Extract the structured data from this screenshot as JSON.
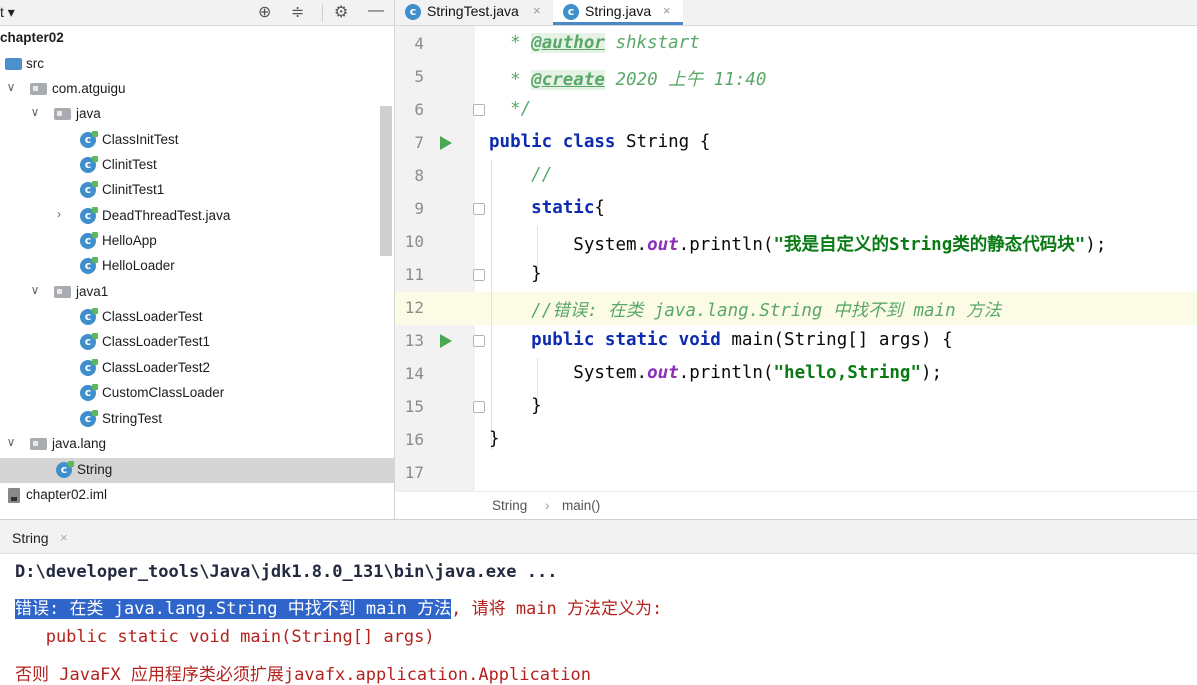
{
  "project_panel": {
    "title": "t",
    "tree": [
      {
        "label": "chapter02",
        "type": "module"
      },
      {
        "label": "src",
        "type": "src-folder"
      },
      {
        "label": "com.atguigu",
        "type": "package"
      },
      {
        "label": "java",
        "type": "package"
      },
      {
        "label": "ClassInitTest",
        "type": "class"
      },
      {
        "label": "ClinitTest",
        "type": "class"
      },
      {
        "label": "ClinitTest1",
        "type": "class"
      },
      {
        "label": "DeadThreadTest.java",
        "type": "class"
      },
      {
        "label": "HelloApp",
        "type": "class"
      },
      {
        "label": "HelloLoader",
        "type": "class"
      },
      {
        "label": "java1",
        "type": "package"
      },
      {
        "label": "ClassLoaderTest",
        "type": "class"
      },
      {
        "label": "ClassLoaderTest1",
        "type": "class"
      },
      {
        "label": "ClassLoaderTest2",
        "type": "class"
      },
      {
        "label": "CustomClassLoader",
        "type": "class"
      },
      {
        "label": "StringTest",
        "type": "class"
      },
      {
        "label": "java.lang",
        "type": "package"
      },
      {
        "label": "String",
        "type": "class",
        "selected": true
      },
      {
        "label": "chapter02.iml",
        "type": "file"
      }
    ]
  },
  "editor": {
    "tabs": [
      {
        "label": "StringTest.java",
        "active": false
      },
      {
        "label": "String.java",
        "active": true
      }
    ],
    "line_numbers": [
      "4",
      "5",
      "6",
      "7",
      "8",
      "9",
      "10",
      "11",
      "12",
      "13",
      "14",
      "15",
      "16",
      "17"
    ],
    "code": {
      "l4_tag": "@author",
      "l4_text": " shkstart",
      "l5_tag": "@create",
      "l5_text": " 2020 上午 11:40",
      "l6": "*/",
      "l7_kw": "public class",
      "l7_text": " String {",
      "l8": "//",
      "l9_kw": "static",
      "l9_text": "{",
      "l10_a": "System.",
      "l10_field": "out",
      "l10_b": ".println(",
      "l10_str": "\"我是自定义的String类的静态代码块\"",
      "l10_c": ");",
      "l11": "}",
      "l12": "//错误: 在类 java.lang.String 中找不到 main 方法",
      "l13_kw": "public static void",
      "l13_text": " main(String[] args) {",
      "l14_a": "System.",
      "l14_field": "out",
      "l14_b": ".println(",
      "l14_str": "\"hello,String\"",
      "l14_c": ");",
      "l15": "}",
      "l16": "}"
    },
    "breadcrumbs": [
      "String",
      "›",
      "main()"
    ]
  },
  "run_console": {
    "tab_label": "String",
    "lines": {
      "cmd": "D:\\developer_tools\\Java\\jdk1.8.0_131\\bin\\java.exe ...",
      "err_selected": "错误: 在类 java.lang.String 中找不到 main 方法",
      "err_rest": ", 请将 main 方法定义为:",
      "signature": "   public static void main(String[] args)",
      "javafx": "否则 JavaFX 应用程序类必须扩展javafx.application.Application"
    }
  }
}
